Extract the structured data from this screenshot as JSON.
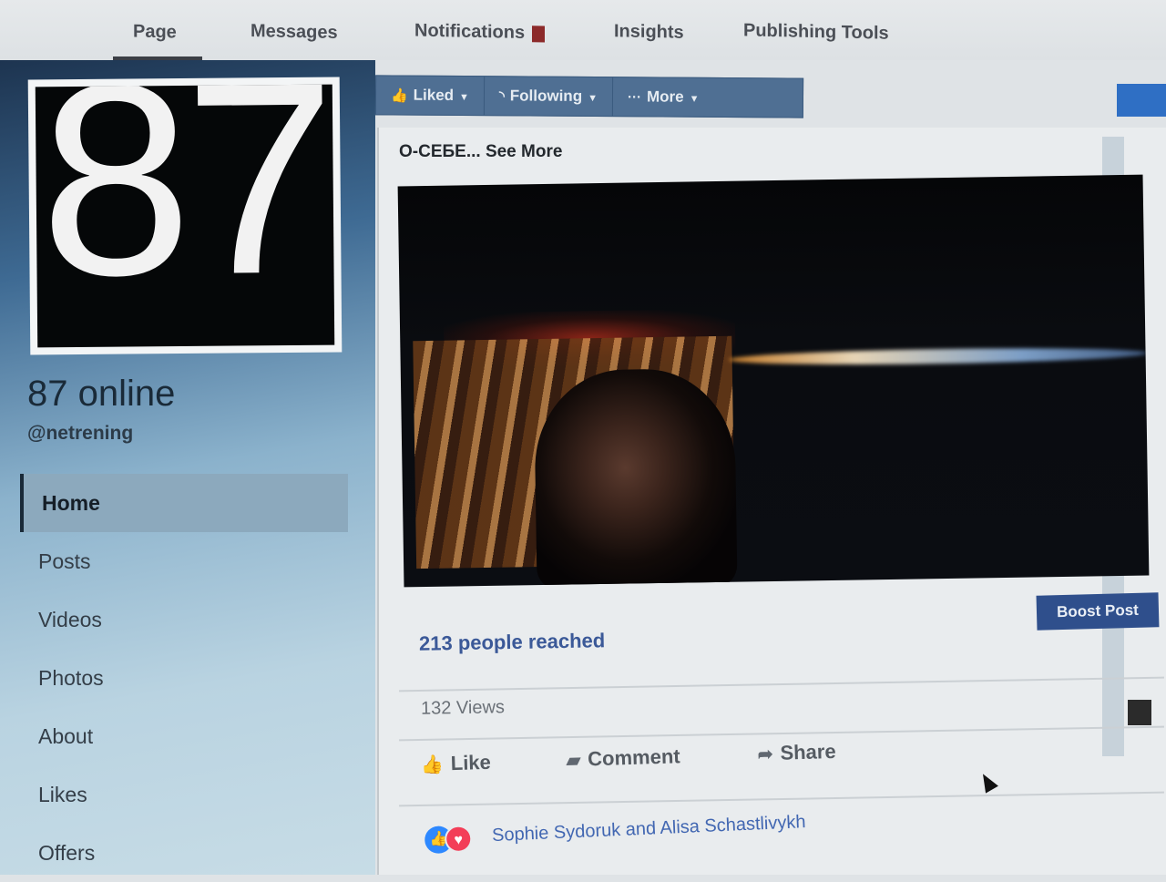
{
  "topnav": {
    "tabs": [
      "Page",
      "Messages",
      "Notifications",
      "Insights",
      "Publishing Tools"
    ]
  },
  "profile": {
    "picture_text": "87",
    "name": "87 online",
    "handle": "@netrening"
  },
  "sidebar": {
    "items": [
      {
        "label": "Home",
        "active": true
      },
      {
        "label": "Posts"
      },
      {
        "label": "Videos"
      },
      {
        "label": "Photos"
      },
      {
        "label": "About"
      },
      {
        "label": "Likes"
      },
      {
        "label": "Offers"
      }
    ]
  },
  "actions": {
    "liked": "Liked",
    "following": "Following",
    "more": "More"
  },
  "post": {
    "about": "О-СЕБЕ... See More",
    "reached": "213 people reached",
    "boost_label": "Boost Post",
    "views": "132 Views",
    "like": "Like",
    "comment": "Comment",
    "share": "Share",
    "reactors": "Sophie Sydoruk and Alisa Schastlivykh"
  }
}
